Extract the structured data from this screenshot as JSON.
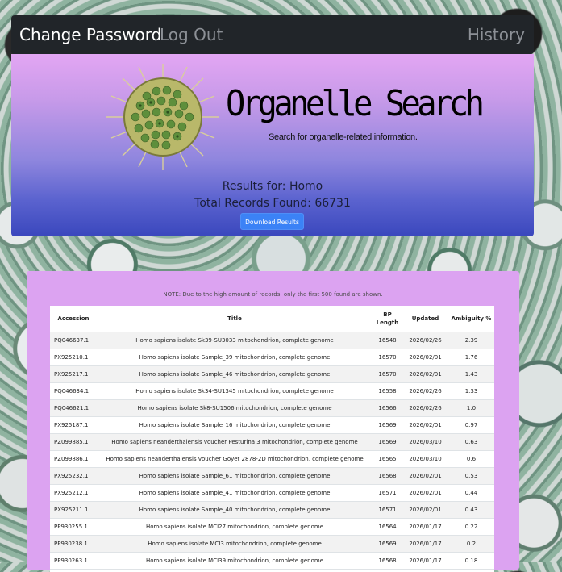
{
  "nav": {
    "change_password": "Change Password",
    "log_out": "Log Out",
    "history": "History"
  },
  "hero": {
    "title": "Organelle Search",
    "subtitle": "Search for organelle-related information.",
    "results_for": "Results for: Homo",
    "total_found": "Total Records Found: 66731",
    "download_label": "Download Results"
  },
  "note": "NOTE: Due to the high amount of records, only the first 500 found are shown.",
  "table": {
    "headers": {
      "accession": "Accession",
      "title": "Title",
      "bp_length": "BP Length",
      "updated": "Updated",
      "ambiguity": "Ambiguity %"
    },
    "rows": [
      {
        "accession": "PQ046637.1",
        "title": "Homo sapiens isolate Sk39-SU3033 mitochondrion, complete genome",
        "bp_length": "16548",
        "updated": "2026/02/26",
        "ambiguity": "2.39"
      },
      {
        "accession": "PX925210.1",
        "title": "Homo sapiens isolate Sample_39 mitochondrion, complete genome",
        "bp_length": "16570",
        "updated": "2026/02/01",
        "ambiguity": "1.76"
      },
      {
        "accession": "PX925217.1",
        "title": "Homo sapiens isolate Sample_46 mitochondrion, complete genome",
        "bp_length": "16570",
        "updated": "2026/02/01",
        "ambiguity": "1.43"
      },
      {
        "accession": "PQ046634.1",
        "title": "Homo sapiens isolate Sk34-SU1345 mitochondrion, complete genome",
        "bp_length": "16558",
        "updated": "2026/02/26",
        "ambiguity": "1.33"
      },
      {
        "accession": "PQ046621.1",
        "title": "Homo sapiens isolate Sk8-SU1506 mitochondrion, complete genome",
        "bp_length": "16566",
        "updated": "2026/02/26",
        "ambiguity": "1.0"
      },
      {
        "accession": "PX925187.1",
        "title": "Homo sapiens isolate Sample_16 mitochondrion, complete genome",
        "bp_length": "16569",
        "updated": "2026/02/01",
        "ambiguity": "0.97"
      },
      {
        "accession": "PZ099885.1",
        "title": "Homo sapiens neanderthalensis voucher Pesturina 3 mitochondrion, complete genome",
        "bp_length": "16569",
        "updated": "2026/03/10",
        "ambiguity": "0.63"
      },
      {
        "accession": "PZ099886.1",
        "title": "Homo sapiens neanderthalensis voucher Goyet 2878-2D mitochondrion, complete genome",
        "bp_length": "16565",
        "updated": "2026/03/10",
        "ambiguity": "0.6"
      },
      {
        "accession": "PX925232.1",
        "title": "Homo sapiens isolate Sample_61 mitochondrion, complete genome",
        "bp_length": "16568",
        "updated": "2026/02/01",
        "ambiguity": "0.53"
      },
      {
        "accession": "PX925212.1",
        "title": "Homo sapiens isolate Sample_41 mitochondrion, complete genome",
        "bp_length": "16571",
        "updated": "2026/02/01",
        "ambiguity": "0.44"
      },
      {
        "accession": "PX925211.1",
        "title": "Homo sapiens isolate Sample_40 mitochondrion, complete genome",
        "bp_length": "16571",
        "updated": "2026/02/01",
        "ambiguity": "0.43"
      },
      {
        "accession": "PP930255.1",
        "title": "Homo sapiens isolate MCI27 mitochondrion, complete genome",
        "bp_length": "16564",
        "updated": "2026/01/17",
        "ambiguity": "0.22"
      },
      {
        "accession": "PP930238.1",
        "title": "Homo sapiens isolate MCI3 mitochondrion, complete genome",
        "bp_length": "16569",
        "updated": "2026/01/17",
        "ambiguity": "0.2"
      },
      {
        "accession": "PP930263.1",
        "title": "Homo sapiens isolate MCI39 mitochondrion, complete genome",
        "bp_length": "16568",
        "updated": "2026/01/17",
        "ambiguity": "0.18"
      }
    ]
  }
}
